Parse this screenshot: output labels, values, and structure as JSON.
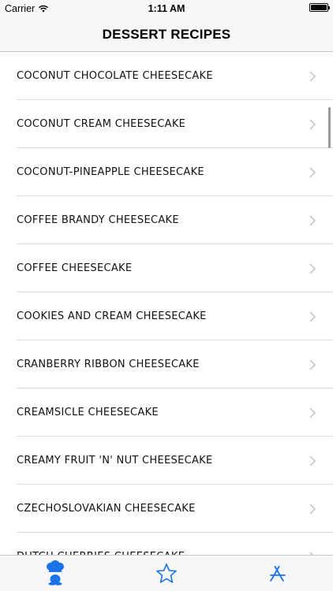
{
  "status_bar": {
    "carrier": "Carrier",
    "time": "1:11 AM",
    "battery_level": 1.0
  },
  "nav": {
    "title": "DESSERT RECIPES"
  },
  "recipes": [
    "COCONUT CHOCOLATE CHEESECAKE",
    "COCONUT CREAM CHEESECAKE",
    "COCONUT-PINEAPPLE CHEESECAKE",
    "COFFEE BRANDY CHEESECAKE",
    "COFFEE CHEESECAKE",
    "COOKIES AND CREAM CHEESECAKE",
    "CRANBERRY RIBBON CHEESECAKE",
    "CREAMSICLE CHEESECAKE",
    "CREAMY FRUIT 'N' NUT CHEESECAKE",
    "CZECHOSLOVAKIAN CHEESECAKE",
    "DUTCH CHERRIES CHEESECAKE"
  ],
  "tabs": [
    {
      "icon": "chef-icon",
      "selected": true
    },
    {
      "icon": "star-icon",
      "selected": false
    },
    {
      "icon": "app-store-icon",
      "selected": false
    }
  ],
  "colors": {
    "accent": "#1a73e8",
    "chevron": "#c7c7cc",
    "bar_background": "#f7f7f7"
  }
}
